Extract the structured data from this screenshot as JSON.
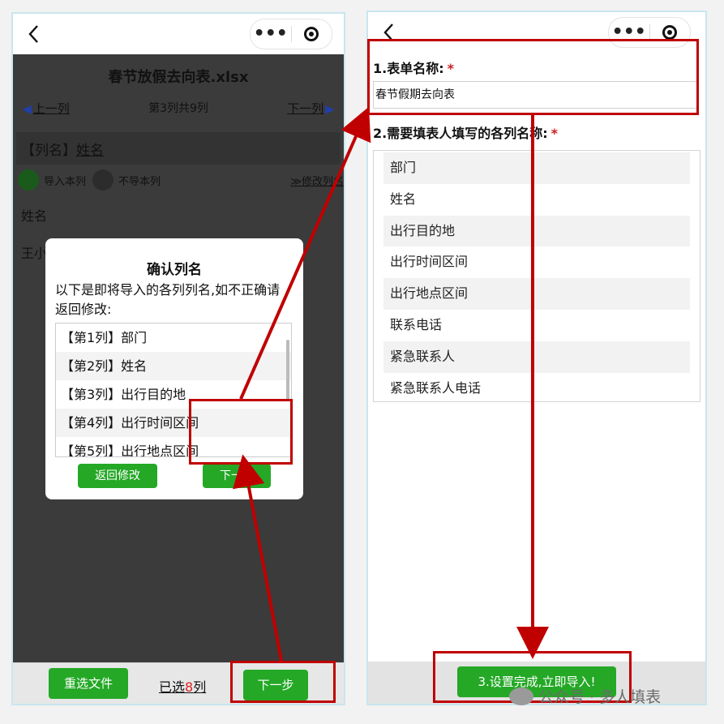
{
  "left_phone": {
    "file_title": "春节放假去向表.xlsx",
    "nav": {
      "prev": "上一列",
      "counter": "第3列共9列",
      "next": "下一列"
    },
    "column_prefix": "【列名】",
    "column_name": "姓名",
    "import_on": "导入本列",
    "import_off": "不导本列",
    "modify_link": "修改列名",
    "fragment_name": "姓名",
    "fragment_wang": "王小",
    "modal": {
      "title": "确认列名",
      "description": "以下是即将导入的各列列名,如不正确请返回修改:",
      "items": [
        "【第1列】部门",
        "【第2列】姓名",
        "【第3列】出行目的地",
        "【第4列】出行时间区间",
        "【第5列】出行地点区间"
      ],
      "back_button": "返回修改",
      "next_button": "下一步"
    },
    "bottom": {
      "reselect": "重选文件",
      "selected_prefix": "已选",
      "selected_count": "8",
      "selected_suffix": "列",
      "next": "下一步"
    }
  },
  "right_phone": {
    "section1_label": "1.表单名称:",
    "form_name_value": "春节假期去向表",
    "section2_label": "2.需要填表人填写的各列名称:",
    "required_mark": "*",
    "columns": [
      "部门",
      "姓名",
      "出行目的地",
      "出行时间区间",
      "出行地点区间",
      "联系电话",
      "紧急联系人",
      "紧急联系人电话"
    ],
    "finish_button": "3.设置完成,立即导入!"
  },
  "watermark": "公众号 · 多人填表",
  "colors": {
    "green": "#24a826",
    "annotation_red": "#c00000",
    "required_red": "#d02020"
  },
  "icons": [
    "back-arrow-icon",
    "more-dots-icon",
    "target-icon"
  ]
}
